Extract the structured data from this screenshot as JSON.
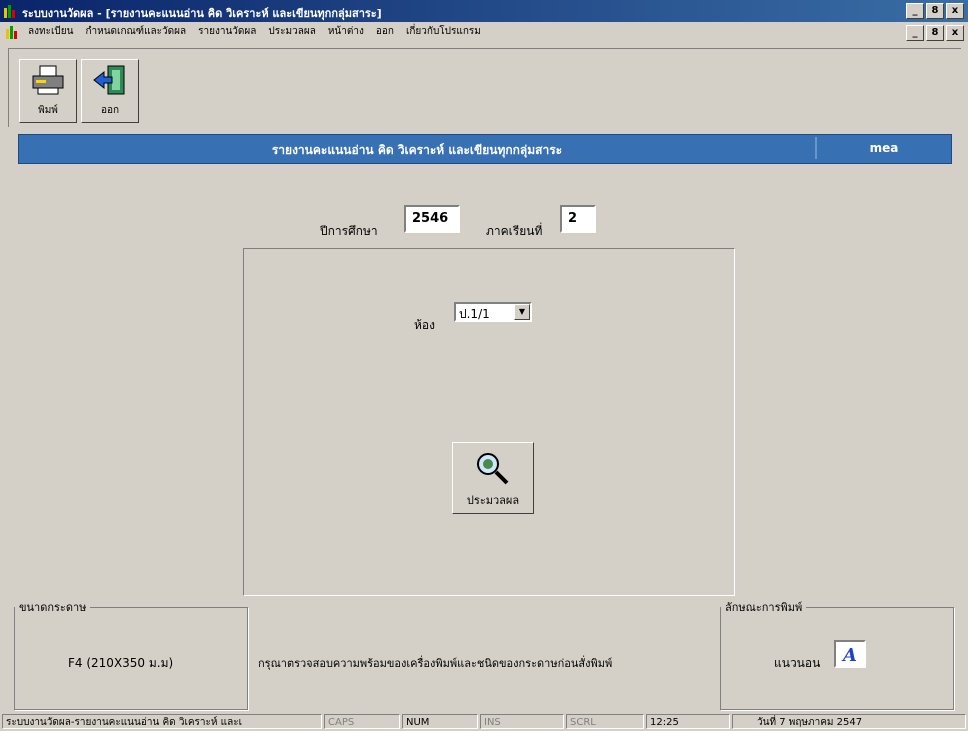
{
  "window": {
    "title": "ระบบงานวัดผล - [รายงานคะแนนอ่าน คิด วิเคราะห์ และเขียนทุกกลุ่มสาระ]"
  },
  "window_buttons": [
    "_",
    "8",
    "x"
  ],
  "menu": {
    "items": [
      "ลงทะเบียน",
      "กำหนดเกณฑ์และวัดผล",
      "รายงานวัดผล",
      "ประมวลผล",
      "หน้าต่าง",
      "ออก",
      "เกี่ยวกับโปรแกรม"
    ]
  },
  "toolbar": {
    "print_label": "พิมพ์",
    "exit_label": "ออก"
  },
  "report": {
    "title": "รายงานคะแนนอ่าน คิด วิเคราะห์ และเขียนทุกกลุ่มสาระ",
    "user": "mea"
  },
  "form": {
    "year_label": "ปีการศึกษา",
    "year_value": "2546",
    "term_label": "ภาคเรียนที่",
    "term_value": "2",
    "room_label": "ห้อง",
    "room_value": "ป.1/1",
    "process_label": "ประมวลผล"
  },
  "paper": {
    "legend": "ขนาดกระดาษ",
    "value": "F4 (210X350 ม.ม)"
  },
  "notice": "กรุณาตรวจสอบความพร้อมของเครื่องพิมพ์และชนิดของกระดาษก่อนสั่งพิมพ์",
  "orientation": {
    "legend": "ลักษณะการพิมพ์",
    "label": "แนวนอน",
    "icon_letter": "A"
  },
  "statusbar": {
    "message": "ระบบงานวัดผล-รายงานคะแนนอ่าน คิด วิเคราะห์ และเ",
    "caps": "CAPS",
    "num": "NUM",
    "ins": "INS",
    "scrl": "SCRL",
    "time": "12:25",
    "date": "วันที่ 7 พฤษภาคม 2547"
  },
  "colors": {
    "title_bar": "#0a246a",
    "report_bar": "#3870b4",
    "face": "#d4d0c8"
  }
}
